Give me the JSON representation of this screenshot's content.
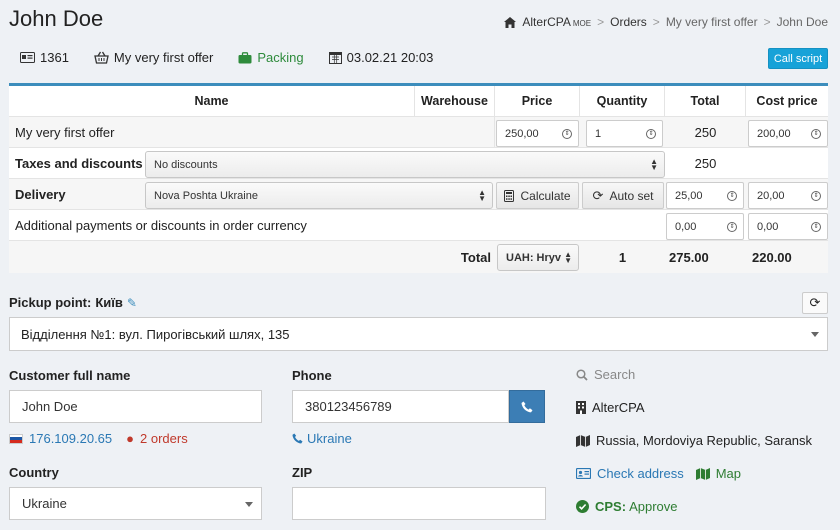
{
  "header": {
    "title": "John Doe",
    "breadcrumb": [
      "AlterCPA",
      "MOE",
      "Orders",
      "My very first offer",
      "John Doe"
    ]
  },
  "info": {
    "id": "1361",
    "offer": "My very first offer",
    "status": "Packing",
    "datetime": "03.02.21 20:03",
    "call_script": "Call script"
  },
  "table": {
    "headers": [
      "Name",
      "Warehouse",
      "Price",
      "Quantity",
      "Total",
      "Cost price"
    ],
    "product": {
      "name": "My very first offer",
      "price": "250,00",
      "quantity": "1",
      "total": "250",
      "cost": "200,00"
    },
    "taxes": {
      "label": "Taxes and discounts",
      "select": "No discounts",
      "total": "250"
    },
    "delivery": {
      "label": "Delivery",
      "select": "Nova Poshta Ukraine",
      "calculate": "Calculate",
      "autoset": "Auto set",
      "price": "25,00",
      "cost": "20,00"
    },
    "additional": {
      "label": "Additional payments or discounts in order currency",
      "price": "0,00",
      "cost": "0,00"
    },
    "totals": {
      "label": "Total",
      "currency": "UAH: Hryv",
      "quantity": "1",
      "total": "275.00",
      "cost": "220.00"
    }
  },
  "pickup": {
    "label": "Pickup point:",
    "city": "Київ",
    "value": "Відділення №1: вул. Пирогівський шлях, 135"
  },
  "form": {
    "name_label": "Customer full name",
    "name_value": "John Doe",
    "ip": "176.109.20.65",
    "orders": "2 orders",
    "phone_label": "Phone",
    "phone_value": "380123456789",
    "phone_country": "Ukraine",
    "country_label": "Country",
    "country_value": "Ukraine",
    "zip_label": "ZIP",
    "zip_value": ""
  },
  "side": {
    "search": "Search",
    "company": "AlterCPA",
    "location": "Russia, Mordoviya Republic, Saransk",
    "check_address": "Check address",
    "map": "Map",
    "cps_label": "CPS:",
    "cps_value": "Approve"
  },
  "colors": {
    "accent": "#3c8dbc",
    "call_script": "#17a2d8",
    "status_green": "#2e8b3c",
    "danger": "#c0392b"
  }
}
